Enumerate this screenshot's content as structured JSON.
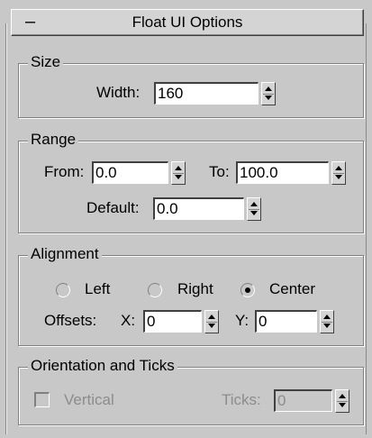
{
  "rollout": {
    "title": "Float UI Options",
    "collapse_symbol": "–"
  },
  "size": {
    "legend": "Size",
    "width": {
      "label": "Width:",
      "value": "160"
    }
  },
  "range": {
    "legend": "Range",
    "from": {
      "label": "From:",
      "value": "0.0"
    },
    "to": {
      "label": "To:",
      "value": "100.0"
    },
    "default": {
      "label": "Default:",
      "value": "0.0"
    }
  },
  "alignment": {
    "legend": "Alignment",
    "options": [
      {
        "label": "Left",
        "selected": false
      },
      {
        "label": "Right",
        "selected": false
      },
      {
        "label": "Center",
        "selected": true
      }
    ],
    "offsets_label": "Offsets:",
    "x": {
      "label": "X:",
      "value": "0"
    },
    "y": {
      "label": "Y:",
      "value": "0"
    }
  },
  "orientation": {
    "legend": "Orientation and Ticks",
    "vertical": {
      "label": "Vertical",
      "checked": false,
      "enabled": false
    },
    "ticks": {
      "label": "Ticks:",
      "value": "0",
      "enabled": false
    }
  }
}
